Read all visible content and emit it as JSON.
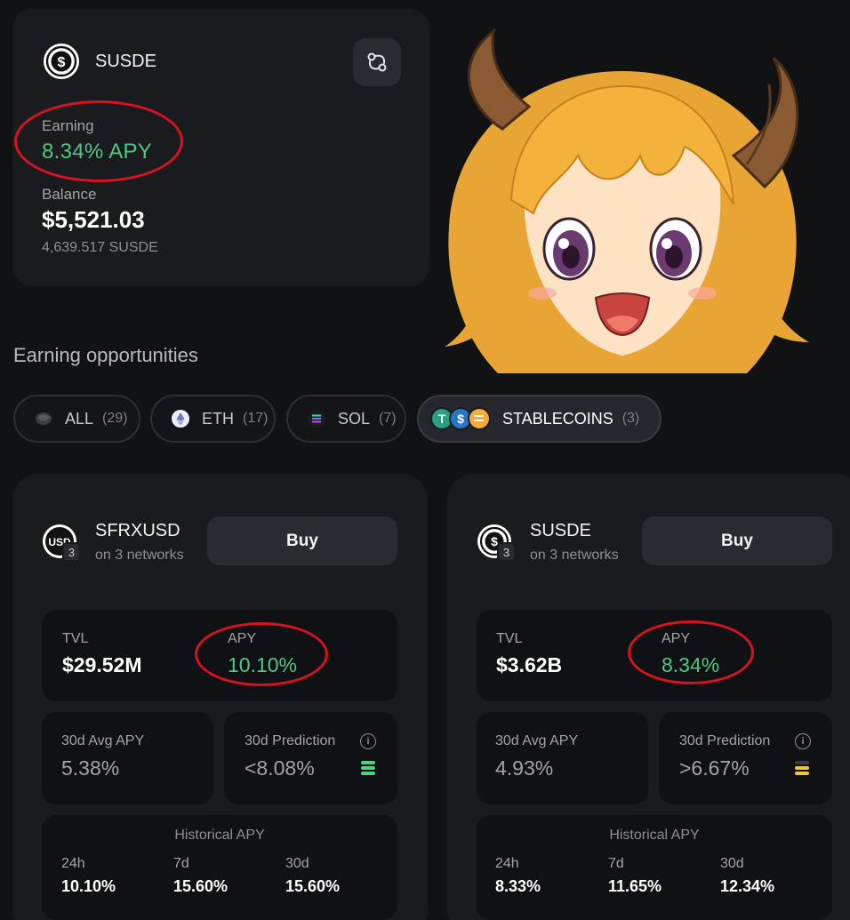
{
  "top_card": {
    "token": "SUSDE",
    "earning_label": "Earning",
    "earning_value": "8.34% APY",
    "balance_label": "Balance",
    "balance_value": "$5,521.03",
    "balance_sub": "4,639.517 SUSDE",
    "swap_icon": "percent-swap-icon"
  },
  "section": {
    "title": "Earning opportunities"
  },
  "filters": [
    {
      "label": "ALL",
      "count": "(29)",
      "icon": "all-icon"
    },
    {
      "label": "ETH",
      "count": "(17)",
      "icon": "eth-icon"
    },
    {
      "label": "SOL",
      "count": "(7)",
      "icon": "sol-icon"
    },
    {
      "label": "STABLECOINS",
      "count": "(3)",
      "icon": "stablecoins-icon",
      "active": true
    }
  ],
  "assets": [
    {
      "name": "SFRXUSD",
      "networks": "on 3 networks",
      "network_count": "3",
      "buy_label": "Buy",
      "tvl_label": "TVL",
      "tvl_value": "$29.52M",
      "apy_label": "APY",
      "apy_value": "10.10%",
      "avg_label": "30d Avg APY",
      "avg_value": "5.38%",
      "pred_label": "30d Prediction",
      "pred_value": "<8.08%",
      "pred_color": "#4fd17f",
      "hist_title": "Historical APY",
      "hist": [
        {
          "label": "24h",
          "value": "10.10%"
        },
        {
          "label": "7d",
          "value": "15.60%"
        },
        {
          "label": "30d",
          "value": "15.60%"
        }
      ]
    },
    {
      "name": "SUSDE",
      "networks": "on 3 networks",
      "network_count": "3",
      "buy_label": "Buy",
      "tvl_label": "TVL",
      "tvl_value": "$3.62B",
      "apy_label": "APY",
      "apy_value": "8.34%",
      "avg_label": "30d Avg APY",
      "avg_value": "4.93%",
      "pred_label": "30d Prediction",
      "pred_value": ">6.67%",
      "pred_color": "#f2c33d",
      "hist_title": "Historical APY",
      "hist": [
        {
          "label": "24h",
          "value": "8.33%"
        },
        {
          "label": "7d",
          "value": "11.65%"
        },
        {
          "label": "30d",
          "value": "12.34%"
        }
      ]
    }
  ],
  "colors": {
    "green": "#4fc882",
    "annotation_red": "#d8121f",
    "background": "#111214",
    "card": "#1a1b1f"
  },
  "mascot": {
    "icon": "anime-girl-mascot"
  }
}
